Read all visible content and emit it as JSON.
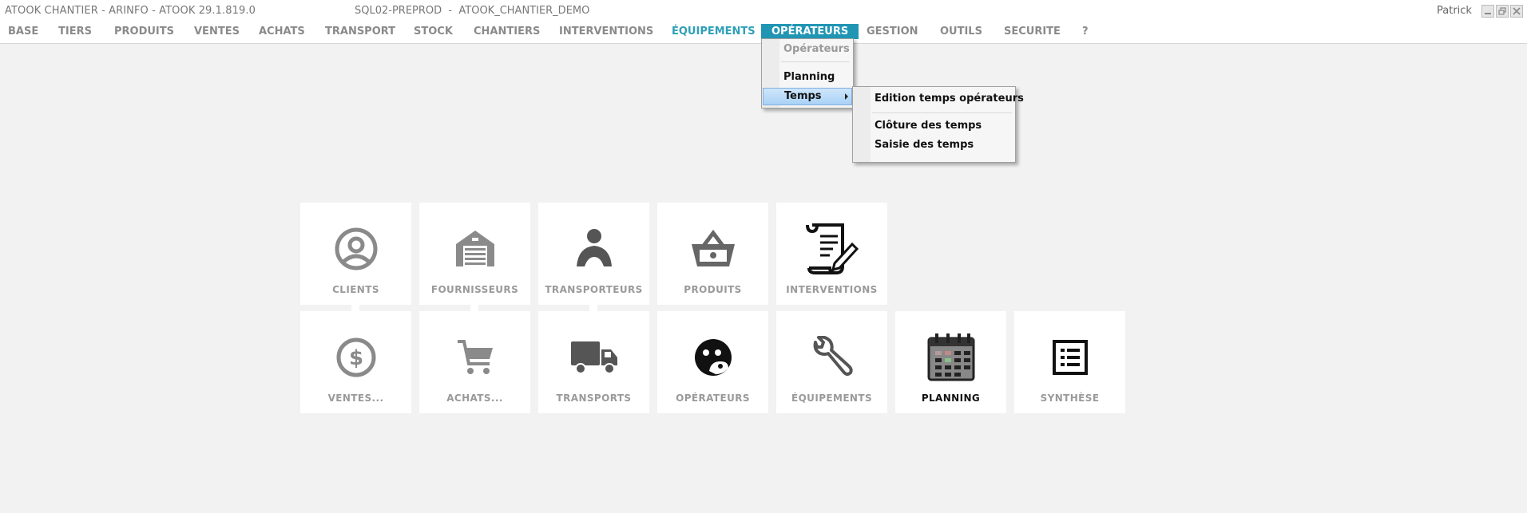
{
  "window": {
    "title": "ATOOK CHANTIER - ARINFO - ATOOK 29.1.819.0",
    "server": "SQL02-PREPROD  -  ATOOK_CHANTIER_DEMO",
    "user": "Patrick"
  },
  "menu": {
    "items": [
      "BASE",
      "TIERS",
      "PRODUITS",
      "VENTES",
      "ACHATS",
      "TRANSPORT",
      "STOCK",
      "CHANTIERS",
      "INTERVENTIONS",
      "ÉQUIPEMENTS",
      "OPÉRATEURS",
      "GESTION",
      "OUTILS",
      "SECURITE",
      "?"
    ]
  },
  "dropdown": {
    "items": [
      "Opérateurs",
      "Planning",
      "Temps"
    ]
  },
  "submenu": {
    "items": [
      "Edition temps opérateurs",
      "Clôture des temps",
      "Saisie des temps"
    ]
  },
  "tiles": {
    "row1": [
      "CLIENTS",
      "FOURNISSEURS",
      "TRANSPORTEURS",
      "PRODUITS",
      "INTERVENTIONS"
    ],
    "row2": [
      "VENTES...",
      "ACHATS...",
      "TRANSPORTS",
      "OPÉRATEURS",
      "ÉQUIPEMENTS",
      "PLANNING",
      "SYNTHÈSE"
    ]
  },
  "icons": {
    "tiles_row1": [
      "user-circle-icon",
      "garage-icon",
      "driver-icon",
      "basket-icon",
      "scroll-pen-icon"
    ],
    "tiles_row2": [
      "dollar-circle-icon",
      "cart-icon",
      "truck-icon",
      "face-icon",
      "wrench-icon",
      "calendar-icon",
      "list-icon"
    ]
  },
  "colors": {
    "accent": "#2196b4",
    "accent_text": "#2e9fb7",
    "highlight": "#a9d1f5",
    "tile_bg": "#ffffff",
    "desktop_bg": "#f2f2f2"
  }
}
